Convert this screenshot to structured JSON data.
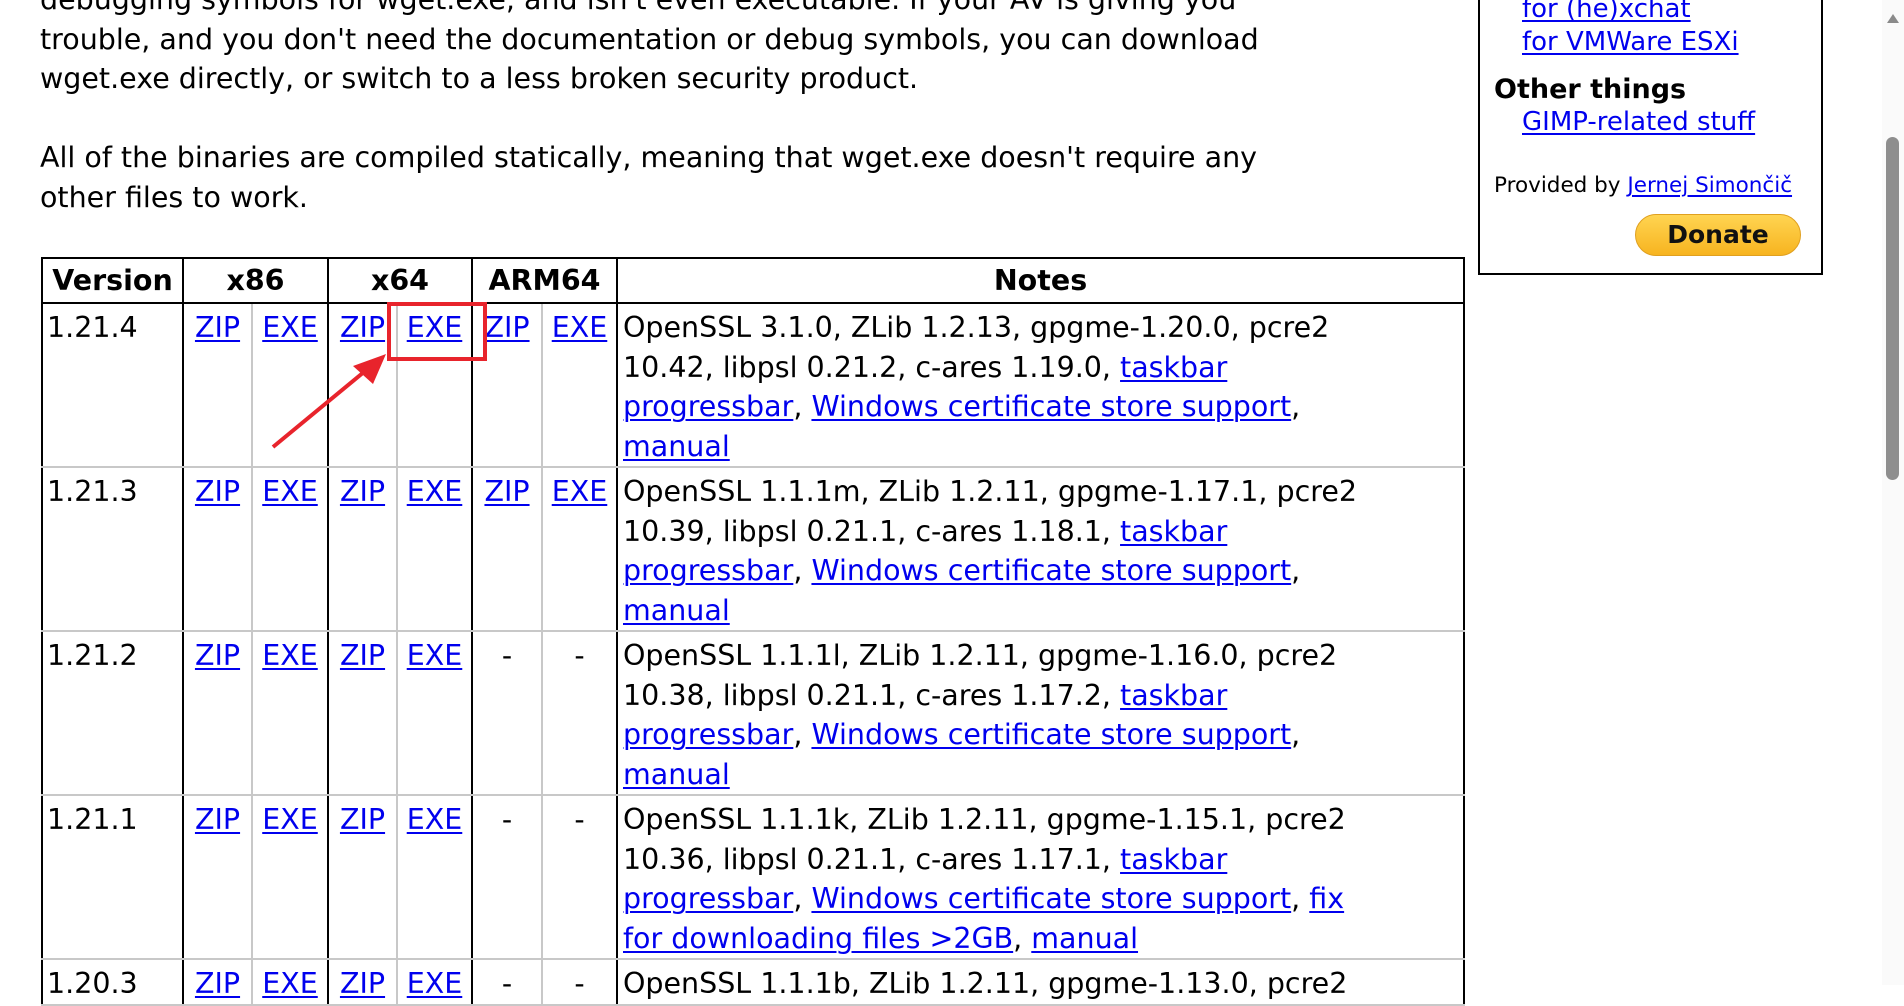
{
  "intro": {
    "paragraph1": [
      "debugging symbols for wget.exe, and isn't even executable. If your AV is giving you",
      "trouble, and you don't need the documentation or debug symbols, you can download",
      "wget.exe directly, or switch to a less broken security product."
    ],
    "paragraph2": [
      "All of the binaries are compiled statically, meaning that wget.exe doesn't require any",
      "other files to work."
    ]
  },
  "sidebar": {
    "links": [
      "for (he)xchat",
      "for VMWare ESXi"
    ],
    "other_heading": "Other things",
    "other_links": [
      "GIMP-related stuff"
    ],
    "provided_by": "Provided by ",
    "author": "Jernej Simončič",
    "donate": "Donate",
    "donate_color": "#ffc439"
  },
  "table": {
    "headers": [
      "Version",
      "x86",
      "x64",
      "ARM64",
      "Notes"
    ],
    "rows": [
      {
        "version": "1.21.4",
        "cells": [
          {
            "t": "ZIP",
            "l": true
          },
          {
            "t": "EXE",
            "l": true
          },
          {
            "t": "ZIP",
            "l": true
          },
          {
            "t": "EXE",
            "l": true
          },
          {
            "t": "ZIP",
            "l": true
          },
          {
            "t": "EXE",
            "l": true
          }
        ],
        "notes": [
          [
            {
              "t": "OpenSSL 3.1.0, ZLib 1.2.13, gpgme-1.20.0, pcre2"
            }
          ],
          [
            {
              "t": "10.42, libpsl 0.21.2, c-ares 1.19.0, "
            },
            {
              "t": "taskbar",
              "l": true
            }
          ],
          [
            {
              "t": "progressbar",
              "l": true
            },
            {
              "t": ", "
            },
            {
              "t": "Windows certificate store support",
              "l": true
            },
            {
              "t": ","
            }
          ],
          [
            {
              "t": "manual",
              "l": true
            }
          ]
        ]
      },
      {
        "version": "1.21.3",
        "cells": [
          {
            "t": "ZIP",
            "l": true
          },
          {
            "t": "EXE",
            "l": true
          },
          {
            "t": "ZIP",
            "l": true
          },
          {
            "t": "EXE",
            "l": true
          },
          {
            "t": "ZIP",
            "l": true
          },
          {
            "t": "EXE",
            "l": true
          }
        ],
        "notes": [
          [
            {
              "t": "OpenSSL 1.1.1m, ZLib 1.2.11, gpgme-1.17.1, pcre2"
            }
          ],
          [
            {
              "t": "10.39, libpsl 0.21.1, c-ares 1.18.1, "
            },
            {
              "t": "taskbar",
              "l": true
            }
          ],
          [
            {
              "t": "progressbar",
              "l": true
            },
            {
              "t": ", "
            },
            {
              "t": "Windows certificate store support",
              "l": true
            },
            {
              "t": ","
            }
          ],
          [
            {
              "t": "manual",
              "l": true
            }
          ]
        ]
      },
      {
        "version": "1.21.2",
        "cells": [
          {
            "t": "ZIP",
            "l": true
          },
          {
            "t": "EXE",
            "l": true
          },
          {
            "t": "ZIP",
            "l": true
          },
          {
            "t": "EXE",
            "l": true
          },
          {
            "t": "-"
          },
          {
            "t": "-"
          }
        ],
        "notes": [
          [
            {
              "t": "OpenSSL 1.1.1l, ZLib 1.2.11, gpgme-1.16.0, pcre2"
            }
          ],
          [
            {
              "t": "10.38, libpsl 0.21.1, c-ares 1.17.2, "
            },
            {
              "t": "taskbar",
              "l": true
            }
          ],
          [
            {
              "t": "progressbar",
              "l": true
            },
            {
              "t": ", "
            },
            {
              "t": "Windows certificate store support",
              "l": true
            },
            {
              "t": ","
            }
          ],
          [
            {
              "t": "manual",
              "l": true
            }
          ]
        ]
      },
      {
        "version": "1.21.1",
        "cells": [
          {
            "t": "ZIP",
            "l": true
          },
          {
            "t": "EXE",
            "l": true
          },
          {
            "t": "ZIP",
            "l": true
          },
          {
            "t": "EXE",
            "l": true
          },
          {
            "t": "-"
          },
          {
            "t": "-"
          }
        ],
        "notes": [
          [
            {
              "t": "OpenSSL 1.1.1k, ZLib 1.2.11, gpgme-1.15.1, pcre2"
            }
          ],
          [
            {
              "t": "10.36, libpsl 0.21.1, c-ares 1.17.1, "
            },
            {
              "t": "taskbar",
              "l": true
            }
          ],
          [
            {
              "t": "progressbar",
              "l": true
            },
            {
              "t": ", "
            },
            {
              "t": "Windows certificate store support",
              "l": true
            },
            {
              "t": ", "
            },
            {
              "t": "fix",
              "l": true
            }
          ],
          [
            {
              "t": "for downloading files >2GB",
              "l": true
            },
            {
              "t": ", "
            },
            {
              "t": "manual",
              "l": true
            }
          ]
        ]
      },
      {
        "version": "1.20.3",
        "cells": [
          {
            "t": "ZIP",
            "l": true
          },
          {
            "t": "EXE",
            "l": true
          },
          {
            "t": "ZIP",
            "l": true
          },
          {
            "t": "EXE",
            "l": true
          },
          {
            "t": "-"
          },
          {
            "t": "-"
          }
        ],
        "notes": [
          [
            {
              "t": "OpenSSL 1.1.1b, ZLib 1.2.11, gpgme-1.13.0, pcre2"
            }
          ]
        ]
      }
    ]
  },
  "annotation": {
    "color": "#e8242c",
    "shapes": [
      "highlight-box",
      "arrow"
    ]
  }
}
